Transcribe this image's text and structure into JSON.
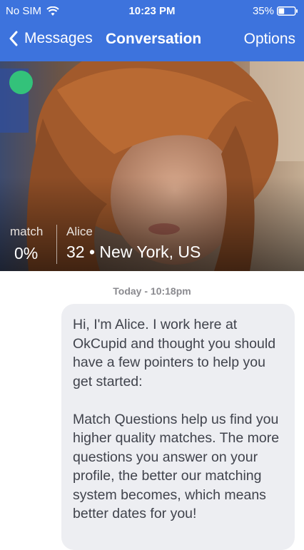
{
  "status_bar": {
    "carrier": "No SIM",
    "time": "10:23 PM",
    "battery_percent": "35%",
    "battery_level": 0.35
  },
  "nav": {
    "back_label": "Messages",
    "title": "Conversation",
    "options_label": "Options"
  },
  "profile": {
    "online_color": "#33c27a",
    "match_label": "match",
    "match_value": "0%",
    "name": "Alice",
    "details": "32 • New York, US"
  },
  "conversation": {
    "timestamp": "Today - 10:18pm",
    "message": {
      "paragraph_1": "Hi, I'm Alice. I work here at OkCupid and thought you should have a few pointers to help you get started:",
      "paragraph_2": "Match Questions help us find you higher quality matches. The more questions you answer on your profile, the better our matching system becomes, which means better dates for you!"
    }
  },
  "colors": {
    "header_blue": "#3d73dd",
    "bubble_bg": "#edeef2"
  }
}
